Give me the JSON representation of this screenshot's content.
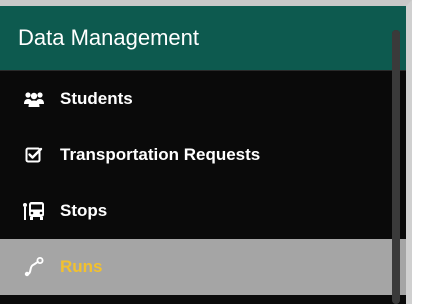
{
  "sidebar": {
    "header": "Data Management",
    "items": [
      {
        "label": "Students",
        "icon": "users-icon",
        "active": false
      },
      {
        "label": "Transportation Requests",
        "icon": "checkbox-icon",
        "active": false
      },
      {
        "label": "Stops",
        "icon": "bus-stop-icon",
        "active": false
      },
      {
        "label": "Runs",
        "icon": "route-icon",
        "active": true
      }
    ]
  },
  "colors": {
    "header_bg": "#0d5a4f",
    "panel_bg": "#0a0a0a",
    "active_bg": "#a5a5a5",
    "active_text": "#f2c12e",
    "text": "#ffffff"
  }
}
